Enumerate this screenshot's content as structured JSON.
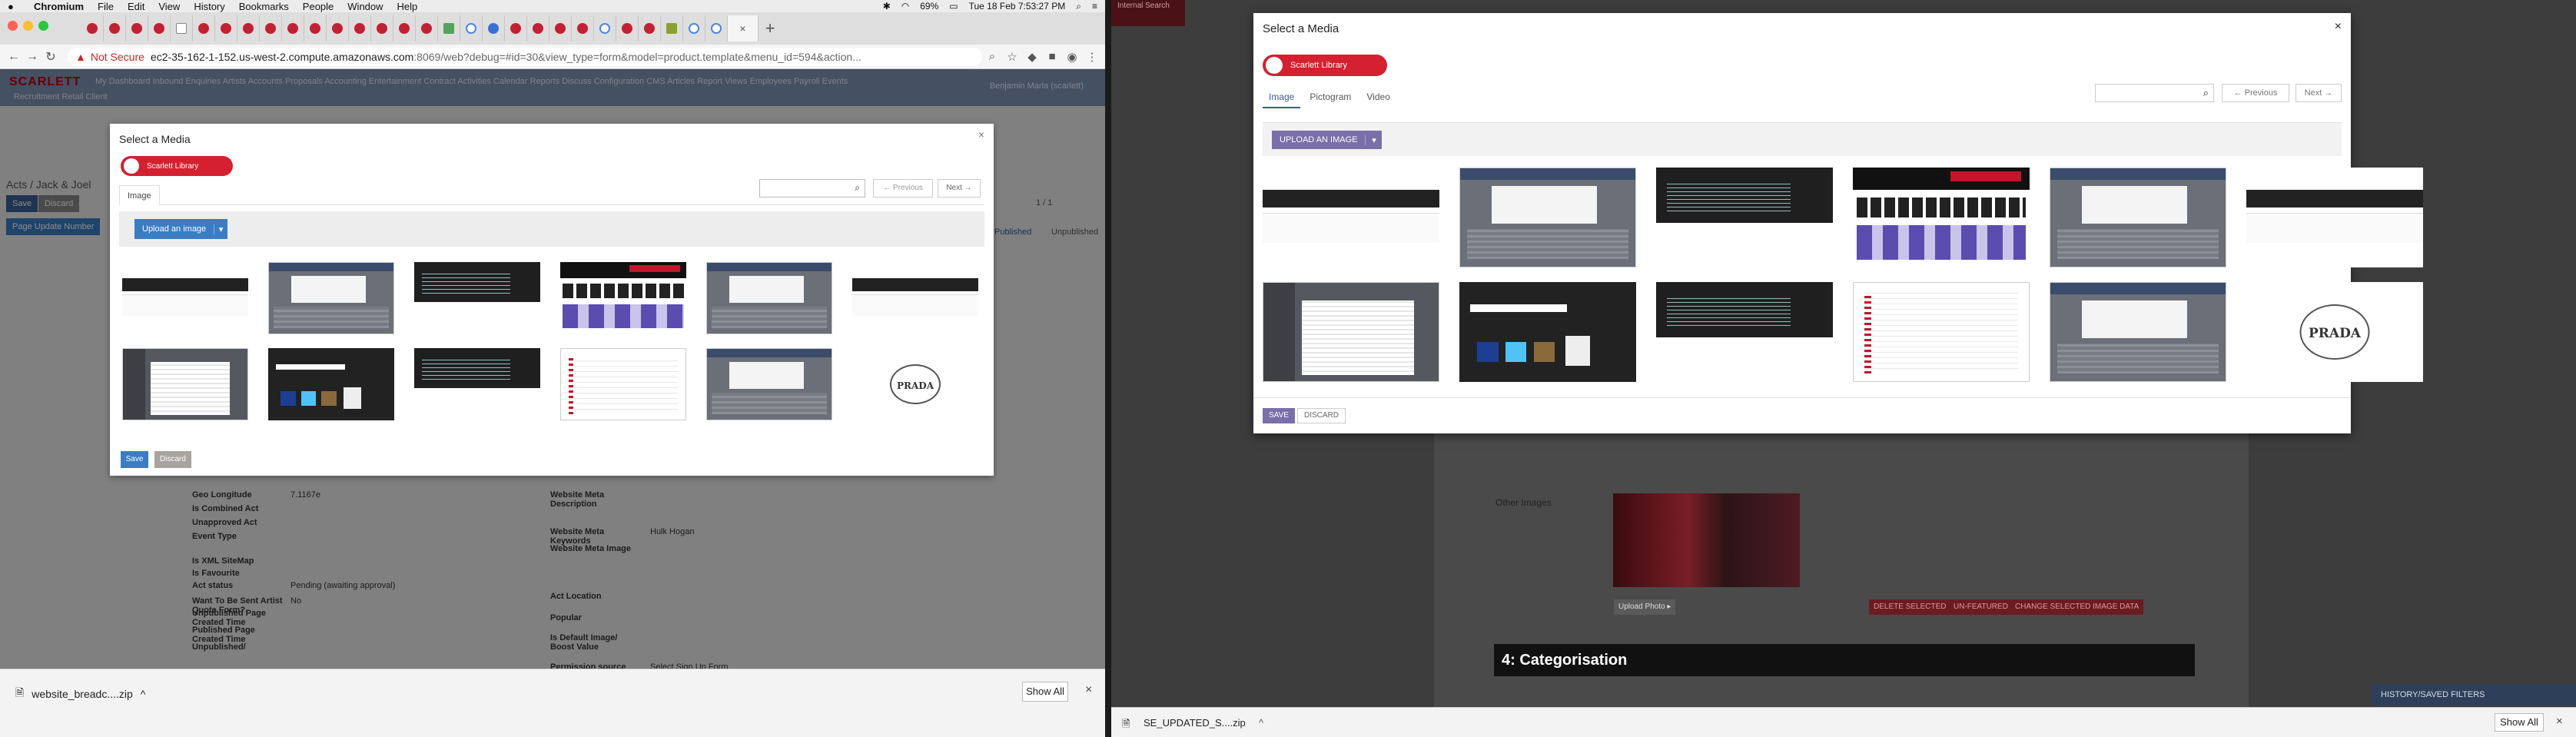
{
  "menubar": {
    "app": "Chromium",
    "items": [
      "File",
      "Edit",
      "View",
      "History",
      "Bookmarks",
      "People",
      "Window",
      "Help"
    ],
    "battery": "69%",
    "clock": "Tue 18 Feb  7:53:27 PM"
  },
  "left_browser": {
    "tab_favicons": [
      "red",
      "red",
      "red",
      "red",
      "doc",
      "red",
      "red",
      "red",
      "red",
      "red",
      "red",
      "red",
      "red",
      "red",
      "red",
      "red",
      "green",
      "g",
      "blue",
      "red",
      "red",
      "red",
      "red",
      "g",
      "red",
      "red",
      "olive",
      "g",
      "g"
    ],
    "new_tab": "+",
    "url": {
      "security": "Not Secure",
      "host": "ec2-35-162-1-152.us-west-2.compute.amazonaws.com",
      "rest": ":8069/web?debug=#id=30&view_type=form&model=product.template&menu_id=594&action..."
    },
    "page": {
      "brand": "SCARLETT",
      "nav_links": "My Dashboard   Inbound Enquiries   Artists   Accounts   Proposals   Accounting   Entertainment Contract   Activities   Calendar   Reports   Discuss   Configuration   CMS   Articles   Report Views   Employees   Payroll   Events",
      "sub_links": "Recruitment   Retail Client",
      "breadcrumb": "Acts / Jack & Joel",
      "save": "Save",
      "discard": "Discard",
      "page_update": "Page Update Number",
      "pager": "1 / 1",
      "status_published": "Published",
      "status_unpublished": "Unpublished",
      "user": "Benjamin Marla (scarlett)",
      "form_left": [
        {
          "label": "Geo Longitude",
          "value": "7.1167e"
        },
        {
          "label": "Is Combined Act",
          "value": ""
        },
        {
          "label": "Unapproved Act",
          "value": ""
        },
        {
          "label": "Event Type",
          "value": ""
        },
        {
          "label": "Is XML SiteMap",
          "value": ""
        },
        {
          "label": "Is Favourite",
          "value": ""
        },
        {
          "label": "Act status",
          "value": "Pending (awaiting approval)"
        },
        {
          "label": "Want To Be Sent Artist Quote Form?",
          "value": "No"
        },
        {
          "label": "Unpublished Page Created Time",
          "value": ""
        },
        {
          "label": "Published Page Created Time",
          "value": ""
        },
        {
          "label": "Unpublished/",
          "value": ""
        }
      ],
      "form_right": [
        {
          "label": "Website Meta Description",
          "value": ""
        },
        {
          "label": "Website Meta Keywords",
          "value": "Hulk Hogan"
        },
        {
          "label": "Website Meta Image",
          "value": ""
        },
        {
          "label": "Act Location",
          "value": ""
        },
        {
          "label": "Popular",
          "value": ""
        },
        {
          "label": "Is Default Image/ Boost Value",
          "value": ""
        },
        {
          "label": "Permission source",
          "value": "Select Sign Up Form"
        }
      ]
    },
    "modal": {
      "title": "Select a Media",
      "close": "×",
      "library": "Scarlett Library",
      "tab_image": "Image",
      "search_placeholder": "",
      "prev": "← Previous",
      "next": "Next →",
      "upload": "Upload an image",
      "caret": "▾",
      "save": "Save",
      "discard": "Discard",
      "thumbs": [
        "strip",
        "screenshot",
        "code",
        "inspiration",
        "screenshot",
        "strip",
        "sheet",
        "flags",
        "code",
        "list",
        "screenshot",
        "prada"
      ]
    },
    "downloads": {
      "file": "website_breadc....zip",
      "chevron": "^",
      "show_all": "Show All",
      "close": "×"
    }
  },
  "right_window": {
    "topleft_text": "Internal Search",
    "modal": {
      "title": "Select a Media",
      "close": "×",
      "library": "Scarlett Library",
      "tabs": [
        "Image",
        "Pictogram",
        "Video"
      ],
      "search_placeholder": "",
      "prev": "← Previous",
      "next": "Next →",
      "upload": "UPLOAD AN IMAGE",
      "caret": "▾",
      "save": "SAVE",
      "discard": "DISCARD",
      "thumbs": [
        "strip",
        "screenshot",
        "code",
        "inspiration",
        "screenshot",
        "strip",
        "sheet",
        "flags",
        "code",
        "list",
        "screenshot",
        "prada"
      ]
    },
    "page": {
      "other_images": "Other Images",
      "upload_photo": "Upload Photo ▸",
      "delete_selected": "DELETE SELECTED",
      "un_featured": "UN-FEATURED",
      "change_selected": "CHANGE SELECTED IMAGE DATA",
      "categorisation": "4: Categorisation",
      "history": "HISTORY/SAVED FILTERS"
    },
    "downloads": {
      "file": "SE_UPDATED_S....zip",
      "chevron": "^",
      "show_all": "Show All",
      "close": "×"
    }
  },
  "colors": {
    "brand_red": "#d4202f",
    "odoo_blue": "#3a7dc4",
    "odoo_purple": "#7a6fa8"
  }
}
